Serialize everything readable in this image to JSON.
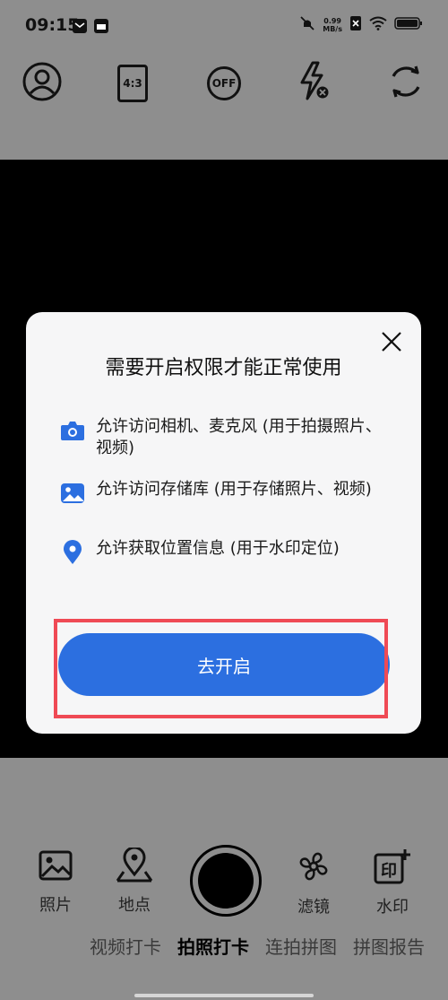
{
  "status": {
    "time": "09:15",
    "speed_value": "0.99",
    "speed_unit": "MB/s",
    "icons": [
      "mail-icon",
      "gallery-icon",
      "mute-icon",
      "sim-icon",
      "wifi-icon",
      "battery-icon"
    ]
  },
  "toolbar": {
    "icons": [
      "profile-icon",
      "aspect-ratio-icon",
      "timer-off-icon",
      "flash-off-icon",
      "switch-camera-icon"
    ],
    "aspect_label": "4:3",
    "timer_label": "OFF"
  },
  "dialog": {
    "title": "需要开启权限才能正常使用",
    "permissions": [
      {
        "icon": "camera-icon",
        "text": "允许访问相机、麦克风 (用于拍摄照片、视频)"
      },
      {
        "icon": "image-icon",
        "text": "允许访问存储库 (用于存储照片、视频)"
      },
      {
        "icon": "location-icon",
        "text": "允许获取位置信息 (用于水印定位)"
      }
    ],
    "primary_button": "去开启"
  },
  "bottom": {
    "items": [
      {
        "label": "照片",
        "icon": "photo-icon"
      },
      {
        "label": "地点",
        "icon": "place-icon"
      },
      {
        "label": "滤镜",
        "icon": "filter-icon"
      },
      {
        "label": "水印",
        "icon": "watermark-icon"
      }
    ],
    "modes": [
      "视频打卡",
      "拍照打卡",
      "连拍拼图",
      "拼图报告"
    ],
    "active_mode": "拍照打卡"
  },
  "colors": {
    "primary": "#2c6fe0",
    "highlight": "#ef4a55",
    "background": "#8e8e8e"
  }
}
